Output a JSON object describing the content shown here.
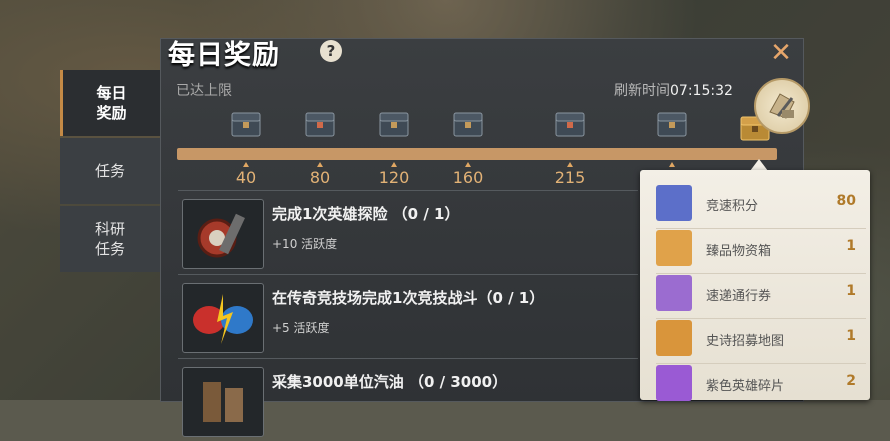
{
  "window": {
    "title": "每日奖励",
    "help_icon": "question-icon",
    "close_icon": "close-icon"
  },
  "sidebar": {
    "items": [
      {
        "label": "每日\n奖励",
        "active": true
      },
      {
        "label": "任务",
        "active": false
      },
      {
        "label": "科研\n任务",
        "active": false
      }
    ]
  },
  "status": {
    "limit_text": "已达上限",
    "refresh_label": "刷新时间",
    "refresh_time": "07:15:32"
  },
  "progress": {
    "milestones": [
      "40",
      "80",
      "120",
      "160",
      "215"
    ],
    "fill_fraction": 1.0
  },
  "quests": [
    {
      "title": "完成1次英雄探险 （0 / 1）",
      "reward": "+10 活跃度",
      "icon": "target-dummy-icon"
    },
    {
      "title": "在传奇竞技场完成1次竞技战斗（0 / 1）",
      "reward": "+5 活跃度",
      "icon": "boxing-gloves-icon"
    },
    {
      "title": "采集3000单位汽油 （0 / 3000）",
      "reward": "",
      "icon": "gasoline-icon"
    }
  ],
  "reward_popup": {
    "items": [
      {
        "name": "竞速积分",
        "count": "80",
        "color": "#5c6fc9",
        "icon": "speed-points-icon"
      },
      {
        "name": "臻品物资箱",
        "count": "1",
        "color": "#e0a24a",
        "icon": "supply-box-icon"
      },
      {
        "name": "速递通行券",
        "count": "1",
        "color": "#9b6cd0",
        "icon": "express-ticket-icon"
      },
      {
        "name": "史诗招募地图",
        "count": "1",
        "color": "#d9953b",
        "icon": "epic-map-icon"
      },
      {
        "name": "紫色英雄碎片",
        "count": "2",
        "color": "#9a5ad4",
        "icon": "hero-shard-icon"
      }
    ]
  }
}
